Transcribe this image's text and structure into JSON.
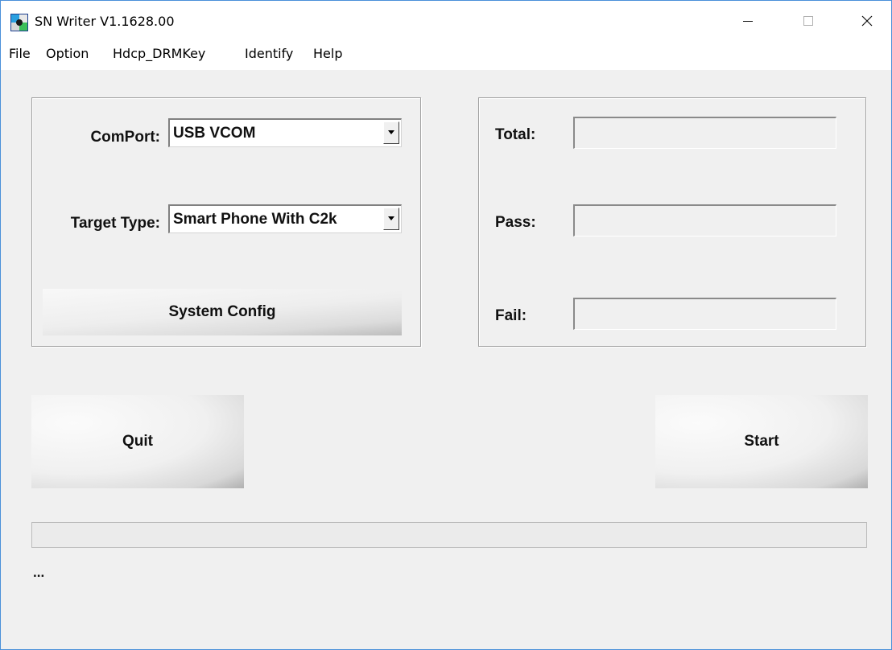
{
  "window": {
    "title": "SN Writer V1.1628.00",
    "icon": "app-icon",
    "controls": {
      "minimize": "minimize-icon",
      "maximize": "maximize-icon",
      "close": "close-icon"
    }
  },
  "menu": {
    "items": [
      "File",
      "Option",
      "Hdcp_DRMKey",
      "Identify",
      "Help"
    ]
  },
  "config_panel": {
    "comport_label": "ComPort:",
    "comport_value": "USB VCOM",
    "target_type_label": "Target Type:",
    "target_type_value": "Smart Phone With C2k",
    "system_config_label": "System Config"
  },
  "stats_panel": {
    "total_label": "Total:",
    "total_value": "",
    "pass_label": "Pass:",
    "pass_value": "",
    "fail_label": "Fail:",
    "fail_value": ""
  },
  "actions": {
    "quit_label": "Quit",
    "start_label": "Start"
  },
  "progress": {
    "value": 0
  },
  "status": {
    "text": "..."
  },
  "colors": {
    "window_border": "#4a90d9",
    "background": "#f0f0f0"
  }
}
